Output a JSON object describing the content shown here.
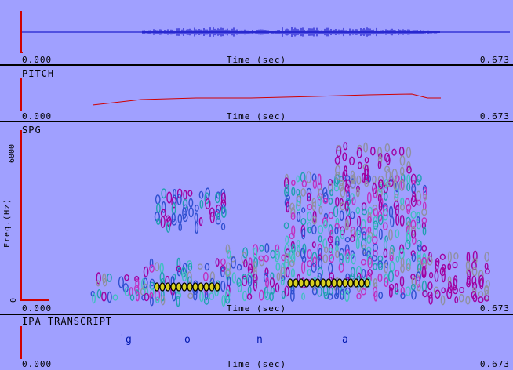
{
  "time_start": "0.000",
  "time_end": "0.673",
  "time_axis_label": "Time (sec)",
  "panels": {
    "waveform": {
      "label": ""
    },
    "pitch": {
      "label": "PITCH"
    },
    "spectrogram": {
      "label": "SPG",
      "freq_max": "6000",
      "freq_min": "0",
      "freq_axis_label": "Freq.(Hz)"
    },
    "ipa": {
      "label": "IPA TRANSCRIPT",
      "stress_mark": "ˈ",
      "segments": [
        "g",
        "o",
        "n",
        "a"
      ]
    }
  },
  "colors": {
    "background": "#a0a0ff",
    "axis": "#d00000",
    "waveform": "#0000c0",
    "pitch": "#d00000",
    "transcript": "#0018b0"
  }
}
